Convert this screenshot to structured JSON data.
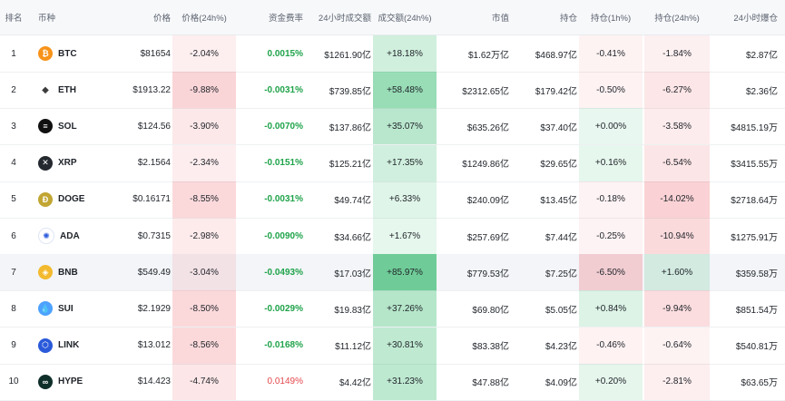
{
  "headers": {
    "rank": "排名",
    "coin": "币种",
    "price": "价格",
    "price_change": "价格(24h%)",
    "funding_rate": "资金费率",
    "volume": "24小时成交额",
    "volume_change": "成交额(24h%)",
    "market_cap": "市值",
    "open_interest": "持仓",
    "oi_change_1h": "持仓(1h%)",
    "oi_change_24h": "持仓(24h%)",
    "liquidation": "24小时爆仓"
  },
  "rows": [
    {
      "rank": "1",
      "symbol": "BTC",
      "icon": "bitcoin-icon",
      "icon_color": "#f7931a",
      "glyph": "₿",
      "price": "$81654",
      "price_change": "-2.04%",
      "funding": "0.0015%",
      "funding_sign": "pos",
      "volume": "$1261.90亿",
      "volume_change": "+18.18%",
      "market_cap": "$1.62万亿",
      "oi": "$468.97亿",
      "oi_1h": "-0.41%",
      "oi_24h": "-1.84%",
      "liq": "$2.87亿"
    },
    {
      "rank": "2",
      "symbol": "ETH",
      "icon": "ethereum-icon",
      "icon_color": "#627eea",
      "glyph": "◆",
      "price": "$1913.22",
      "price_change": "-9.88%",
      "funding": "-0.0031%",
      "funding_sign": "pos",
      "volume": "$739.85亿",
      "volume_change": "+58.48%",
      "market_cap": "$2312.65亿",
      "oi": "$179.42亿",
      "oi_1h": "-0.50%",
      "oi_24h": "-6.27%",
      "liq": "$2.36亿"
    },
    {
      "rank": "3",
      "symbol": "SOL",
      "icon": "solana-icon",
      "icon_color": "#111111",
      "glyph": "≡",
      "price": "$124.56",
      "price_change": "-3.90%",
      "funding": "-0.0070%",
      "funding_sign": "pos",
      "volume": "$137.86亿",
      "volume_change": "+35.07%",
      "market_cap": "$635.26亿",
      "oi": "$37.40亿",
      "oi_1h": "+0.00%",
      "oi_24h": "-3.58%",
      "liq": "$4815.19万"
    },
    {
      "rank": "4",
      "symbol": "XRP",
      "icon": "xrp-icon",
      "icon_color": "#23292f",
      "glyph": "✕",
      "price": "$2.1564",
      "price_change": "-2.34%",
      "funding": "-0.0151%",
      "funding_sign": "pos",
      "volume": "$125.21亿",
      "volume_change": "+17.35%",
      "market_cap": "$1249.86亿",
      "oi": "$29.65亿",
      "oi_1h": "+0.16%",
      "oi_24h": "-6.54%",
      "liq": "$3415.55万"
    },
    {
      "rank": "5",
      "symbol": "DOGE",
      "icon": "dogecoin-icon",
      "icon_color": "#c2a633",
      "glyph": "Ð",
      "price": "$0.16171",
      "price_change": "-8.55%",
      "funding": "-0.0031%",
      "funding_sign": "pos",
      "volume": "$49.74亿",
      "volume_change": "+6.33%",
      "market_cap": "$240.09亿",
      "oi": "$13.45亿",
      "oi_1h": "-0.18%",
      "oi_24h": "-14.02%",
      "liq": "$2718.64万"
    },
    {
      "rank": "6",
      "symbol": "ADA",
      "icon": "cardano-icon",
      "icon_color": "#ffffff",
      "glyph": "✺",
      "price": "$0.7315",
      "price_change": "-2.98%",
      "funding": "-0.0090%",
      "funding_sign": "pos",
      "volume": "$34.66亿",
      "volume_change": "+1.67%",
      "market_cap": "$257.69亿",
      "oi": "$7.44亿",
      "oi_1h": "-0.25%",
      "oi_24h": "-10.94%",
      "liq": "$1275.91万"
    },
    {
      "rank": "7",
      "symbol": "BNB",
      "icon": "bnb-icon",
      "icon_color": "#f3ba2f",
      "glyph": "◈",
      "price": "$549.49",
      "price_change": "-3.04%",
      "funding": "-0.0493%",
      "funding_sign": "pos",
      "volume": "$17.03亿",
      "volume_change": "+85.97%",
      "market_cap": "$779.53亿",
      "oi": "$7.25亿",
      "oi_1h": "-6.50%",
      "oi_24h": "+1.60%",
      "liq": "$359.58万"
    },
    {
      "rank": "8",
      "symbol": "SUI",
      "icon": "sui-icon",
      "icon_color": "#4da2ff",
      "glyph": "💧",
      "price": "$2.1929",
      "price_change": "-8.50%",
      "funding": "-0.0029%",
      "funding_sign": "pos",
      "volume": "$19.83亿",
      "volume_change": "+37.26%",
      "market_cap": "$69.80亿",
      "oi": "$5.05亿",
      "oi_1h": "+0.84%",
      "oi_24h": "-9.94%",
      "liq": "$851.54万"
    },
    {
      "rank": "9",
      "symbol": "LINK",
      "icon": "chainlink-icon",
      "icon_color": "#2a5ada",
      "glyph": "⬡",
      "price": "$13.012",
      "price_change": "-8.56%",
      "funding": "-0.0168%",
      "funding_sign": "pos",
      "volume": "$11.12亿",
      "volume_change": "+30.81%",
      "market_cap": "$83.38亿",
      "oi": "$4.23亿",
      "oi_1h": "-0.46%",
      "oi_24h": "-0.64%",
      "liq": "$540.81万"
    },
    {
      "rank": "10",
      "symbol": "HYPE",
      "icon": "hyperliquid-icon",
      "icon_color": "#0f2f2a",
      "glyph": "∞",
      "price": "$14.423",
      "price_change": "-4.74%",
      "funding": "0.0149%",
      "funding_sign": "neg",
      "volume": "$4.42亿",
      "volume_change": "+31.23%",
      "market_cap": "$47.88亿",
      "oi": "$4.09亿",
      "oi_1h": "+0.20%",
      "oi_24h": "-2.81%",
      "liq": "$63.65万"
    }
  ],
  "colors": {
    "positive_text": "#1fa34a",
    "negative_text": "#e5484d",
    "header_bg": "#f7f8fa"
  }
}
